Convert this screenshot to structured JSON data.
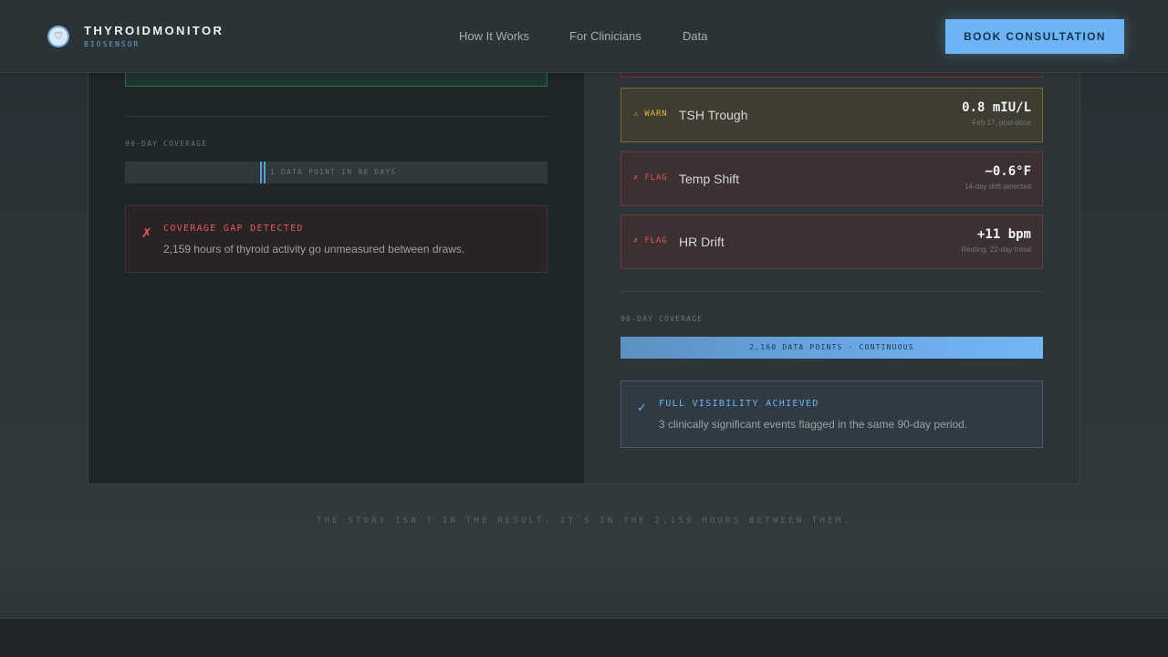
{
  "header": {
    "brand_name": "THYROIDMONITOR",
    "brand_sub": "BIOSENSOR",
    "logo_icon": "heart-icon",
    "nav": [
      "How It Works",
      "For Clinicians",
      "Data"
    ],
    "cta_label": "BOOK CONSULTATION"
  },
  "left": {
    "coverage_label": "90-DAY COVERAGE",
    "coverage_bar_text": "1 DATA POINT IN 90 DAYS",
    "alert": {
      "icon": "x-mark",
      "title": "COVERAGE GAP DETECTED",
      "text": "2,159 hours of thyroid activity go unmeasured between draws."
    }
  },
  "right": {
    "cards": [
      {
        "tag": "⚠ WARN",
        "name": "TSH Trough",
        "value": "0.8 mIU/L",
        "sub": "Feb 17, post-dose",
        "status": "warn"
      },
      {
        "tag": "✗ FLAG",
        "name": "Temp Shift",
        "value": "−0.6°F",
        "sub": "14-day drift detected",
        "status": "flag"
      },
      {
        "tag": "✗ FLAG",
        "name": "HR Drift",
        "value": "+11 bpm",
        "sub": "Resting, 22-day trend",
        "status": "flag"
      }
    ],
    "coverage_label": "90-DAY COVERAGE",
    "coverage_bar_text": "2,160 DATA POINTS · CONTINUOUS",
    "alert": {
      "icon": "check-mark",
      "title": "FULL VISIBILITY ACHIEVED",
      "text": "3 clinically significant events flagged in the same 90-day period."
    }
  },
  "tagline": "THE STORY ISN'T IN THE RESULT. IT'S IN THE 2,159 HOURS BETWEEN THEM.",
  "colors": {
    "accent": "#6db4f7",
    "warn": "#e8b43a",
    "flag": "#e05a5a",
    "ok_border": "#2f6a52"
  }
}
